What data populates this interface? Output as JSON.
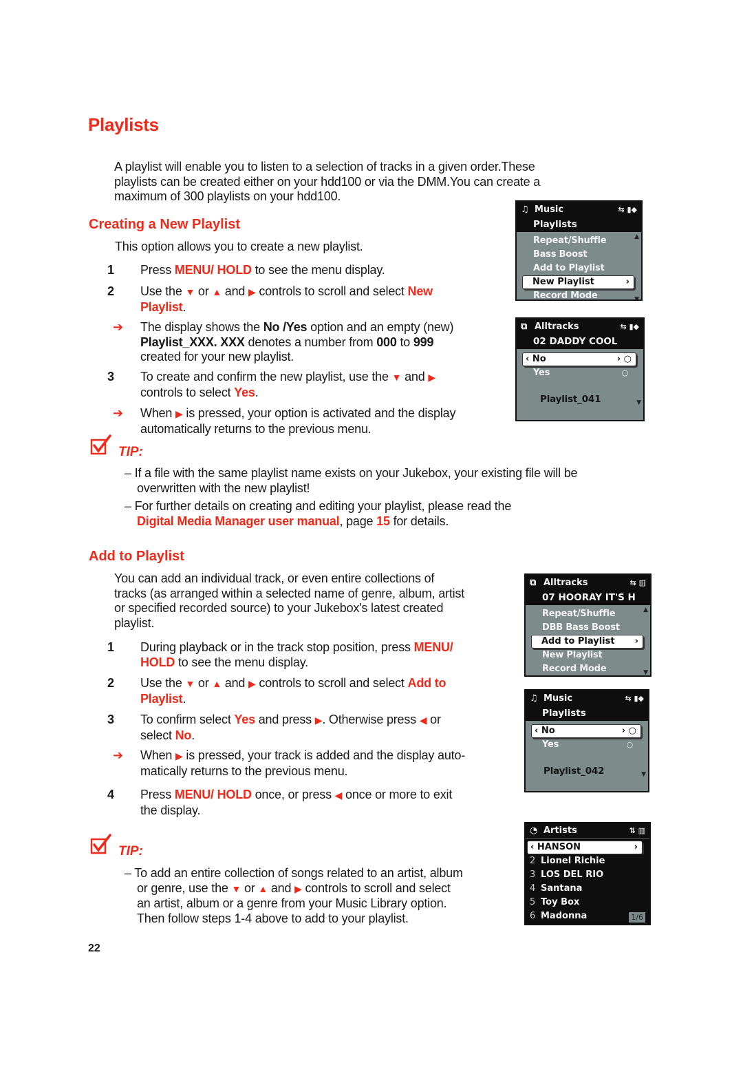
{
  "page": {
    "title": "Playlists",
    "intro": [
      "A playlist will enable you to listen to a selection of tracks in a given order.These",
      "playlists can be created either on your hdd100 or via the DMM.You can create a",
      "maximum of 300 playlists on your hdd100."
    ],
    "page_number": "22",
    "colors": {
      "accent": "#ee2a1b",
      "text": "#1a1a1a",
      "screen_bg": "#7d8c8a",
      "screen_header": "#0e0e0e"
    }
  },
  "creating": {
    "heading": "Creating a New Playlist",
    "intro": "This option allows you to create a new playlist.",
    "step1": {
      "num": "1",
      "pre": "Press ",
      "key": "MENU/ HOLD",
      "post": " to see the menu display."
    },
    "step2": {
      "num": "2",
      "pre": "Use the ",
      "down": "▼",
      "or": " or ",
      "up": "▲",
      "and": " and ",
      "right": "▶",
      "mid": " controls to scroll and select ",
      "key_a": "New",
      "key_b": "Playlist",
      "end": "."
    },
    "note1": {
      "arrow": "➔",
      "a": "The display shows the ",
      "b1": "No /Yes",
      "c": " option and an empty (new)",
      "b2": "Playlist_XXX. XXX",
      "d": " denotes a number from ",
      "b3": "000",
      "e": " to ",
      "b4": "999",
      "f": "created for your new playlist."
    },
    "step3": {
      "num": "3",
      "a": "To create and confirm the new playlist, use the ",
      "down": "▼",
      "and": " and ",
      "right": "▶",
      "b": "controls to select ",
      "key": "Yes",
      "end": "."
    },
    "note2": {
      "arrow": "➔",
      "a": "When ",
      "right": "▶",
      "b": " is pressed, your option is activated and the display",
      "c": "automatically returns to the previous menu."
    }
  },
  "tip1": {
    "label": "TIP:",
    "items": [
      {
        "a": "– If a file with the same playlist name exists on your Jukebox, your existing file will be",
        "b": "overwritten with the new playlist!"
      },
      {
        "a": "– For further details on creating and editing your playlist, please read the",
        "link": "Digital Media Manager user manual",
        "c": ", page ",
        "page": "15",
        "d": " for details."
      }
    ]
  },
  "adding": {
    "heading": "Add to Playlist",
    "intro": [
      "You can add an individual track, or even entire collections of",
      "tracks (as arranged within a selected name of genre, album, artist",
      "or specified recorded source) to your Jukebox's latest created",
      "playlist."
    ],
    "step1": {
      "num": "1",
      "a": "During playback or in the track stop position, press ",
      "key_a": "MENU/",
      "key_b": "HOLD",
      "b": " to see the menu display."
    },
    "step2": {
      "num": "2",
      "pre": "Use the ",
      "down": "▼",
      "or": " or ",
      "up": "▲",
      "and": " and ",
      "right": "▶",
      "mid": " controls to scroll and select ",
      "key_a": "Add to",
      "key_b": "Playlist",
      "end": "."
    },
    "step3": {
      "num": "3",
      "a": "To confirm select ",
      "key": "Yes",
      "b": " and press ",
      "right": "▶",
      "c": ". Otherwise press ",
      "left": "◀",
      "d": " or",
      "e": "select ",
      "key2": "No",
      "end": "."
    },
    "note": {
      "arrow": "➔",
      "a": "When ",
      "right": "▶",
      "b": " is pressed, your track is added and the display auto-",
      "c": "matically returns to the previous menu."
    },
    "step4": {
      "num": "4",
      "pre": "Press ",
      "key": "MENU/ HOLD",
      "a": " once, or press ",
      "left": "◀",
      "b": " once or more to exit",
      "c": "the display."
    }
  },
  "tip2": {
    "label": "TIP:",
    "lines": [
      {
        "a": "– To add an entire collection of songs related to an artist, album"
      },
      {
        "a": "or genre, use the ",
        "down": "▼",
        "or": " or ",
        "up": "▲",
        "and": " and ",
        "right": "▶",
        "b": " controls to scroll and select"
      },
      {
        "a": "an artist, album or a genre from your Music Library option."
      },
      {
        "a": "Then follow steps 1-4 above to add to your playlist."
      }
    ]
  },
  "screens": {
    "s1": {
      "header": "Music",
      "header_icon": "♫",
      "status": "⇆ ▮◆",
      "sub": "Playlists",
      "items": [
        "Repeat/Shuffle",
        "Bass Boost",
        "Add to Playlist"
      ],
      "selected": "New Playlist",
      "selected_right": "›",
      "after": [
        "Record Mode"
      ]
    },
    "s2": {
      "header": "Alltracks",
      "header_icon": "⧉",
      "status": "⇆ ▮◆",
      "sub": "02 DADDY COOL",
      "selected": "‹ No",
      "selected_right": "› ○",
      "option": "Yes",
      "option_radio": "○",
      "playlist": "Playlist_041"
    },
    "s3": {
      "header": "Alltracks",
      "header_icon": "⧉",
      "status": "⇆ ▥",
      "sub": "07 HOORAY IT'S H",
      "items": [
        "Repeat/Shuffle",
        "DBB Bass Boost"
      ],
      "selected": "Add to Playlist",
      "selected_right": "›",
      "after": [
        "New Playlist",
        "Record Mode"
      ]
    },
    "s4": {
      "header": "Music",
      "header_icon": "♫",
      "status": "⇆ ▮◆",
      "sub": "Playlists",
      "selected": "‹ No",
      "selected_right": "› ○",
      "option": "Yes",
      "option_radio": "○",
      "playlist": "Playlist_042"
    },
    "s5": {
      "header": "Artists",
      "header_icon": "◔",
      "status": "⇅ ▥",
      "selected": "‹ HANSON",
      "selected_right": "›",
      "rows": [
        {
          "n": "2",
          "name": "Lionel Richie"
        },
        {
          "n": "3",
          "name": "LOS DEL RIO"
        },
        {
          "n": "4",
          "name": "Santana"
        },
        {
          "n": "5",
          "name": "Toy Box"
        },
        {
          "n": "6",
          "name": "Madonna"
        }
      ],
      "page": "1/6"
    }
  }
}
